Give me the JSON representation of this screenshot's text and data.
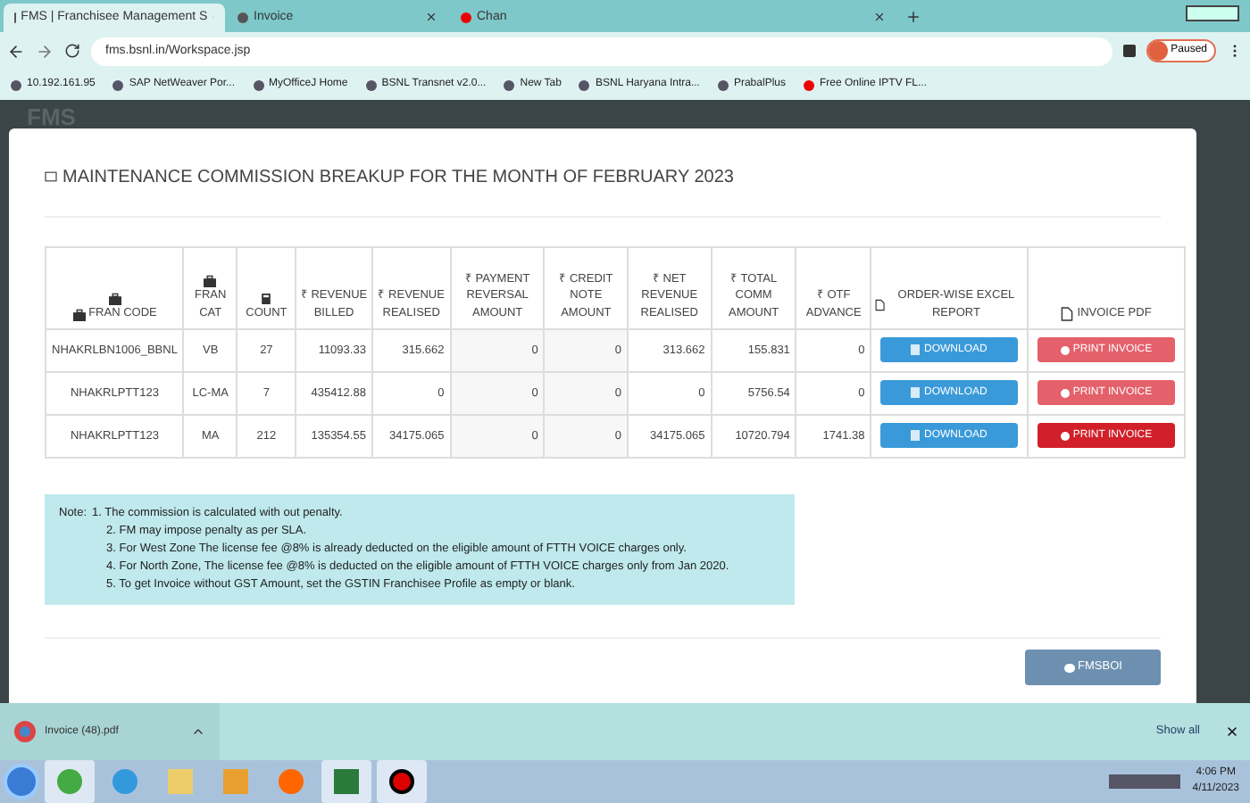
{
  "browser": {
    "tabs": [
      {
        "title": "FMS | Franchisee Management S",
        "selected": true
      },
      {
        "title": "Invoice",
        "selected": false
      },
      {
        "title": "Chan",
        "selected": false
      }
    ],
    "url": "fms.bsnl.in/Workspace.jsp",
    "profile": "Paused",
    "bookmarks": [
      "10.192.161.95",
      "SAP NetWeaver Por...",
      "MyOfficeJ Home",
      "BSNL Transnet v2.0...",
      "New Tab",
      "BSNL Haryana Intra...",
      "PrabalPlus",
      "Free Online IPTV FL..."
    ]
  },
  "page": {
    "brand": "FMS",
    "modal": {
      "title": "MAINTENANCE COMMISSION BREAKUP FOR THE MONTH OF FEBRUARY 2023",
      "table": {
        "columns": [
          "FRAN CODE",
          "FRAN CAT",
          "COUNT",
          "₹ REVENUE BILLED",
          "₹ REVENUE REALISED",
          "₹ PAYMENT REVERSAL AMOUNT",
          "₹ CREDIT NOTE AMOUNT",
          "₹ NET REVENUE REALISED",
          "₹ TOTAL COMM AMOUNT",
          "₹ OTF ADVANCE",
          "ORDER-WISE EXCEL REPORT",
          "INVOICE PDF"
        ],
        "rows": [
          {
            "cells": [
              "NHAKRLBN1006_BBNL",
              "VB",
              "27",
              "11093.33",
              "315.662",
              "0",
              "0",
              "313.662",
              "155.831",
              "0"
            ],
            "download": "DOWNLOAD",
            "print": "PRINT INVOICE",
            "print_highlighted": false
          },
          {
            "cells": [
              "NHAKRLPTT123",
              "LC-MA",
              "7",
              "435412.88",
              "0",
              "0",
              "0",
              "0",
              "5756.54",
              "0"
            ],
            "download": "DOWNLOAD",
            "print": "PRINT INVOICE",
            "print_highlighted": false
          },
          {
            "cells": [
              "NHAKRLPTT123",
              "MA",
              "212",
              "135354.55",
              "34175.065",
              "0",
              "0",
              "34175.065",
              "10720.794",
              "1741.38"
            ],
            "download": "DOWNLOAD",
            "print": "PRINT INVOICE",
            "print_highlighted": true
          }
        ]
      },
      "note_label": "Note:",
      "notes": [
        "1. The commission is calculated with out penalty.",
        "2. FM may impose penalty as per SLA.",
        "3. For West Zone The license fee @8% is already deducted on the eligible amount of FTTH VOICE charges only.",
        "4. For North Zone, The license fee @8% is deducted on the eligible amount of FTTH VOICE charges only from Jan 2020.",
        "5. To get Invoice without GST Amount, set the GSTIN Franchisee Profile as empty or blank."
      ],
      "footer_button": "FMSBOI"
    }
  },
  "downloads": {
    "file": "Invoice (48).pdf",
    "show_all": "Show all"
  },
  "taskbar": {
    "time": "4:06 PM",
    "date": "4/11/2023"
  }
}
